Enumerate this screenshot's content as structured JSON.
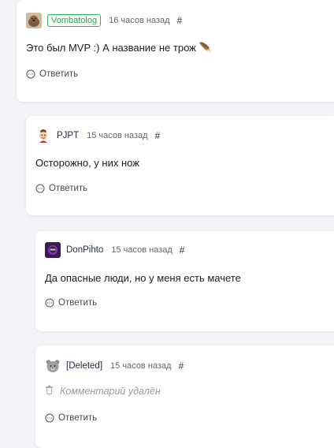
{
  "comments": [
    {
      "avatar_icon": "wombat-avatar-icon",
      "username": "Vombatolog",
      "time": "16 часов назад",
      "permalink": "#",
      "text": "Это был MVP :) А название не трож 🪶",
      "reply": "Ответить"
    },
    {
      "avatar_icon": "cartoon-face-avatar-icon",
      "username": "PJPT",
      "time": "15 часов назад",
      "permalink": "#",
      "text": "Осторожно, у них нож",
      "reply": "Ответить"
    },
    {
      "avatar_icon": "gamer-avatar-icon",
      "username": "DonPihto",
      "time": "15 часов назад",
      "permalink": "#",
      "text": "Да опасные люди, но у меня есть мачете",
      "reply": "Ответить"
    },
    {
      "avatar_icon": "bear-avatar-icon",
      "username": "[Deleted]",
      "time": "15 часов назад",
      "permalink": "#",
      "deleted_text": "Комментарий удалён",
      "reply": "Ответить"
    }
  ],
  "colors": {
    "badge_border": "#33b05a",
    "background": "#f4f4f8"
  }
}
